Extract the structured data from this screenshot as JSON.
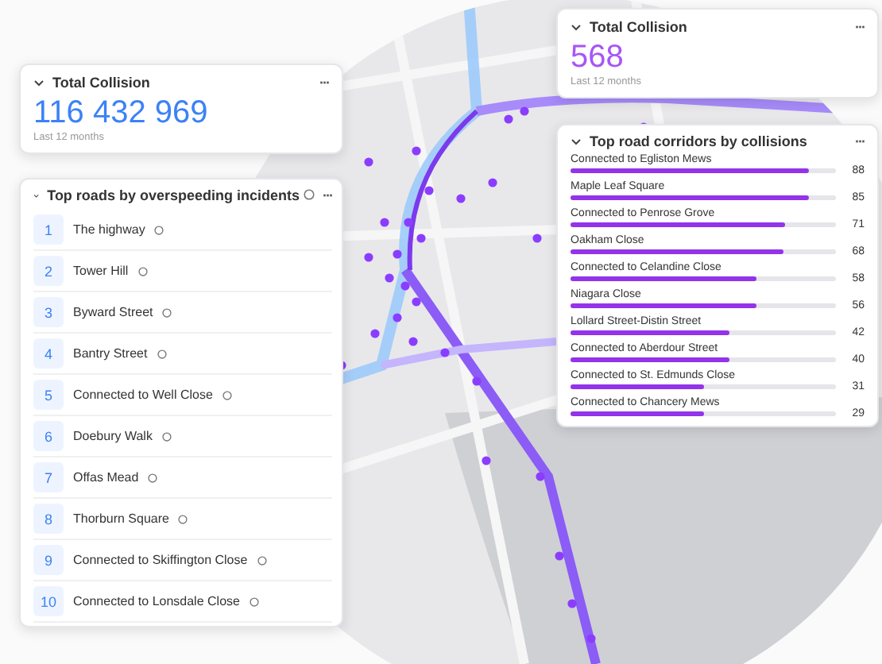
{
  "total_card_left": {
    "title": "Total Collision",
    "value": "116 432 969",
    "caption": "Last 12 months",
    "menu": "···"
  },
  "total_card_right": {
    "title": "Total Collision",
    "value": "568",
    "caption": "Last 12 months",
    "menu": "···"
  },
  "top_roads": {
    "title": "Top roads by overspeeding incidents",
    "menu": "···",
    "items": [
      {
        "rank": "1",
        "name": "The highway"
      },
      {
        "rank": "2",
        "name": "Tower Hill"
      },
      {
        "rank": "3",
        "name": "Byward Street"
      },
      {
        "rank": "4",
        "name": "Bantry Street"
      },
      {
        "rank": "5",
        "name": "Connected to Well Close"
      },
      {
        "rank": "6",
        "name": "Doebury Walk"
      },
      {
        "rank": "7",
        "name": "Offas Mead"
      },
      {
        "rank": "8",
        "name": "Thorburn Square"
      },
      {
        "rank": "9",
        "name": "Connected to Skiffington Close"
      },
      {
        "rank": "10",
        "name": "Connected to Lonsdale Close"
      }
    ]
  },
  "corridors": {
    "title": "Top road corridors by collisions",
    "menu": "···",
    "items": [
      {
        "name": "Connected to Egliston Mews",
        "value": "88",
        "level": 0.9
      },
      {
        "name": "Maple Leaf Square",
        "value": "85",
        "level": 0.9
      },
      {
        "name": "Connected to Penrose Grove",
        "value": "71",
        "level": 0.81
      },
      {
        "name": "Oakham Close",
        "value": "68",
        "level": 0.8
      },
      {
        "name": "Connected to Celandine Close",
        "value": "58",
        "level": 0.7
      },
      {
        "name": "Niagara Close",
        "value": "56",
        "level": 0.7
      },
      {
        "name": "Lollard Street-Distin Street",
        "value": "42",
        "level": 0.6
      },
      {
        "name": "Connected to Aberdour Street",
        "value": "40",
        "level": 0.6
      },
      {
        "name": "Connected to St. Edmunds Close",
        "value": "31",
        "level": 0.5
      },
      {
        "name": "Connected to Chancery Mews",
        "value": "29",
        "level": 0.5
      }
    ]
  }
}
